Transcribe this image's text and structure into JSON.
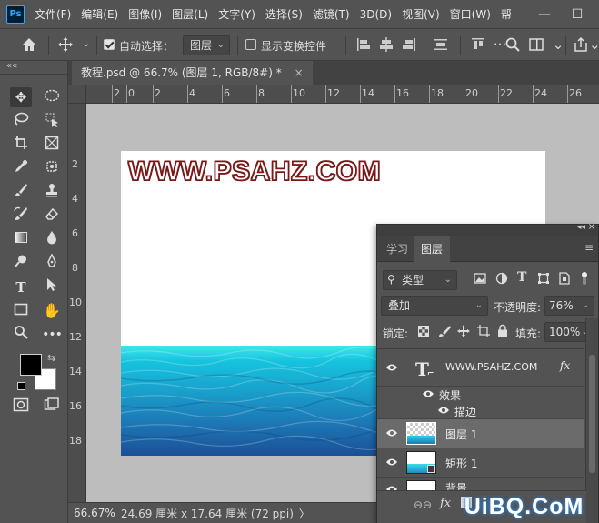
{
  "app": {
    "logo": "Ps",
    "menu": [
      "文件(F)",
      "编辑(E)",
      "图像(I)",
      "图层(L)",
      "文字(Y)",
      "选择(S)",
      "滤镜(T)",
      "3D(D)",
      "视图(V)",
      "窗口(W)",
      "帮"
    ],
    "window_controls": {
      "minimize": "—",
      "restore": "☐"
    }
  },
  "options_bar": {
    "home_icon": "home-icon",
    "move_icon": "move-tool-icon",
    "auto_select_label": "自动选择：",
    "auto_select_checked": true,
    "auto_select_target": "图层",
    "show_transform_label": "显示变换控件",
    "show_transform_checked": false
  },
  "document": {
    "tab_title": "教程.psd @ 66.7% (图层 1, RGB/8#) *",
    "tab_close": "×",
    "ruler_top_ticks": [
      "2",
      "0",
      "2",
      "4",
      "6",
      "8",
      "10",
      "12",
      "14",
      "16",
      "18",
      "20",
      "22",
      "24",
      "26"
    ],
    "ruler_left_ticks": [
      "2",
      "4",
      "6",
      "8",
      "10",
      "12",
      "14",
      "16",
      "18"
    ],
    "canvas_title": "WWW.PSAHZ.COM",
    "background_color": "#ffffff",
    "water_colors": [
      "#3fe6ef",
      "#16c4de",
      "#19a2cc",
      "#1d78b5",
      "#1b4f97"
    ]
  },
  "status": {
    "zoom": "66.67%",
    "doc_size": "24.69 厘米 x 17.64 厘米 (72 ppi)",
    "arrow": "〉"
  },
  "toolbar": {
    "collapse": "««",
    "foreground_color": "#000000",
    "background_color": "#ffffff",
    "tools": [
      "move-tool-icon",
      "marquee-tool-icon",
      "lasso-tool-icon",
      "quick-select-tool-icon",
      "crop-tool-icon",
      "frame-tool-icon",
      "eyedropper-tool-icon",
      "spot-heal-tool-icon",
      "brush-tool-icon",
      "stamp-tool-icon",
      "history-brush-tool-icon",
      "eraser-tool-icon",
      "gradient-tool-icon",
      "blur-tool-icon",
      "dodge-tool-icon",
      "pen-tool-icon",
      "type-tool-icon",
      "path-select-tool-icon",
      "rectangle-tool-icon",
      "hand-tool-icon",
      "zoom-tool-icon",
      "more-tools-icon"
    ]
  },
  "layers_panel": {
    "tabs": [
      "学习",
      "图层"
    ],
    "active_tab": "图层",
    "filter_kind": "类型",
    "blend_mode": "叠加",
    "opacity_label": "不透明度:",
    "opacity_value": "76%",
    "lock_label": "锁定:",
    "fill_label": "填充:",
    "fill_value": "100%",
    "layers": [
      {
        "name": "WWW.PSAHZ.COM",
        "type": "text",
        "visible": true,
        "fx": "fx"
      },
      {
        "name": "效果",
        "type": "effects",
        "visible": true
      },
      {
        "name": "描边",
        "type": "effect",
        "visible": true
      },
      {
        "name": "图层 1",
        "type": "pixel",
        "visible": true,
        "selected": true
      },
      {
        "name": "矩形 1",
        "type": "shape",
        "visible": true
      },
      {
        "name": "背景",
        "type": "background",
        "visible": true
      }
    ],
    "bottom_fx": "fx"
  },
  "watermark": {
    "text": "UiBQ.CoM"
  }
}
